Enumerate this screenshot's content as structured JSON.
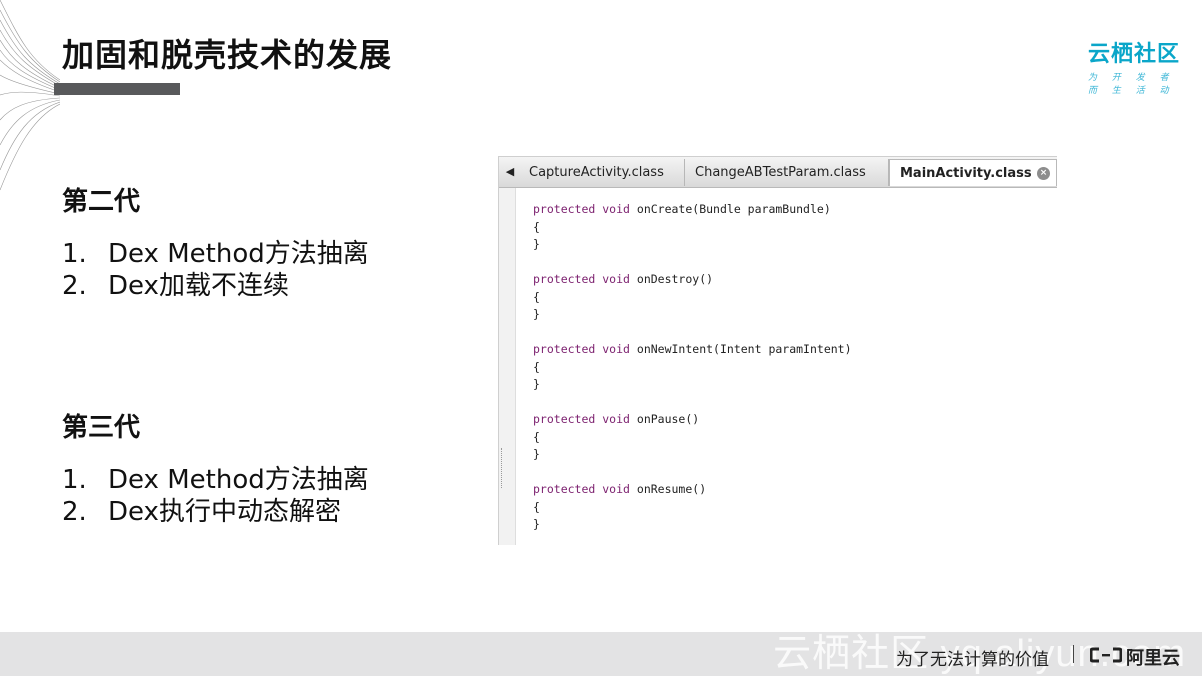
{
  "slide": {
    "title": "加固和脱壳技术的发展"
  },
  "brand": {
    "name": "云栖社区",
    "tagline": "为 开 发 者 而 生 活 动",
    "accent_color": "#0aa6c9"
  },
  "generations": [
    {
      "heading": "第二代",
      "items": [
        {
          "num": "1.",
          "text": "Dex Method方法抽离"
        },
        {
          "num": "2.",
          "text": "Dex加载不连续"
        }
      ]
    },
    {
      "heading": "第三代",
      "items": [
        {
          "num": "1.",
          "text": "Dex Method方法抽离"
        },
        {
          "num": "2.",
          "text": "Dex执行中动态解密"
        }
      ]
    }
  ],
  "code_window": {
    "tabs": [
      {
        "label": "CaptureActivity.class",
        "active": false
      },
      {
        "label": "ChangeABTestParam.class",
        "active": false
      },
      {
        "label": "MainActivity.class",
        "active": true
      }
    ],
    "methods": [
      {
        "modifier": "protected",
        "type": "void",
        "signature": "onCreate(Bundle paramBundle)"
      },
      {
        "modifier": "protected",
        "type": "void",
        "signature": "onDestroy()"
      },
      {
        "modifier": "protected",
        "type": "void",
        "signature": "onNewIntent(Intent paramIntent)"
      },
      {
        "modifier": "protected",
        "type": "void",
        "signature": "onPause()"
      },
      {
        "modifier": "protected",
        "type": "void",
        "signature": "onResume()"
      }
    ],
    "open_brace": "{",
    "close_brace": "}"
  },
  "footer": {
    "watermark": "云栖社区 yq.aliyun.com",
    "slogan": "为了无法计算的价值",
    "company": "阿里云"
  }
}
